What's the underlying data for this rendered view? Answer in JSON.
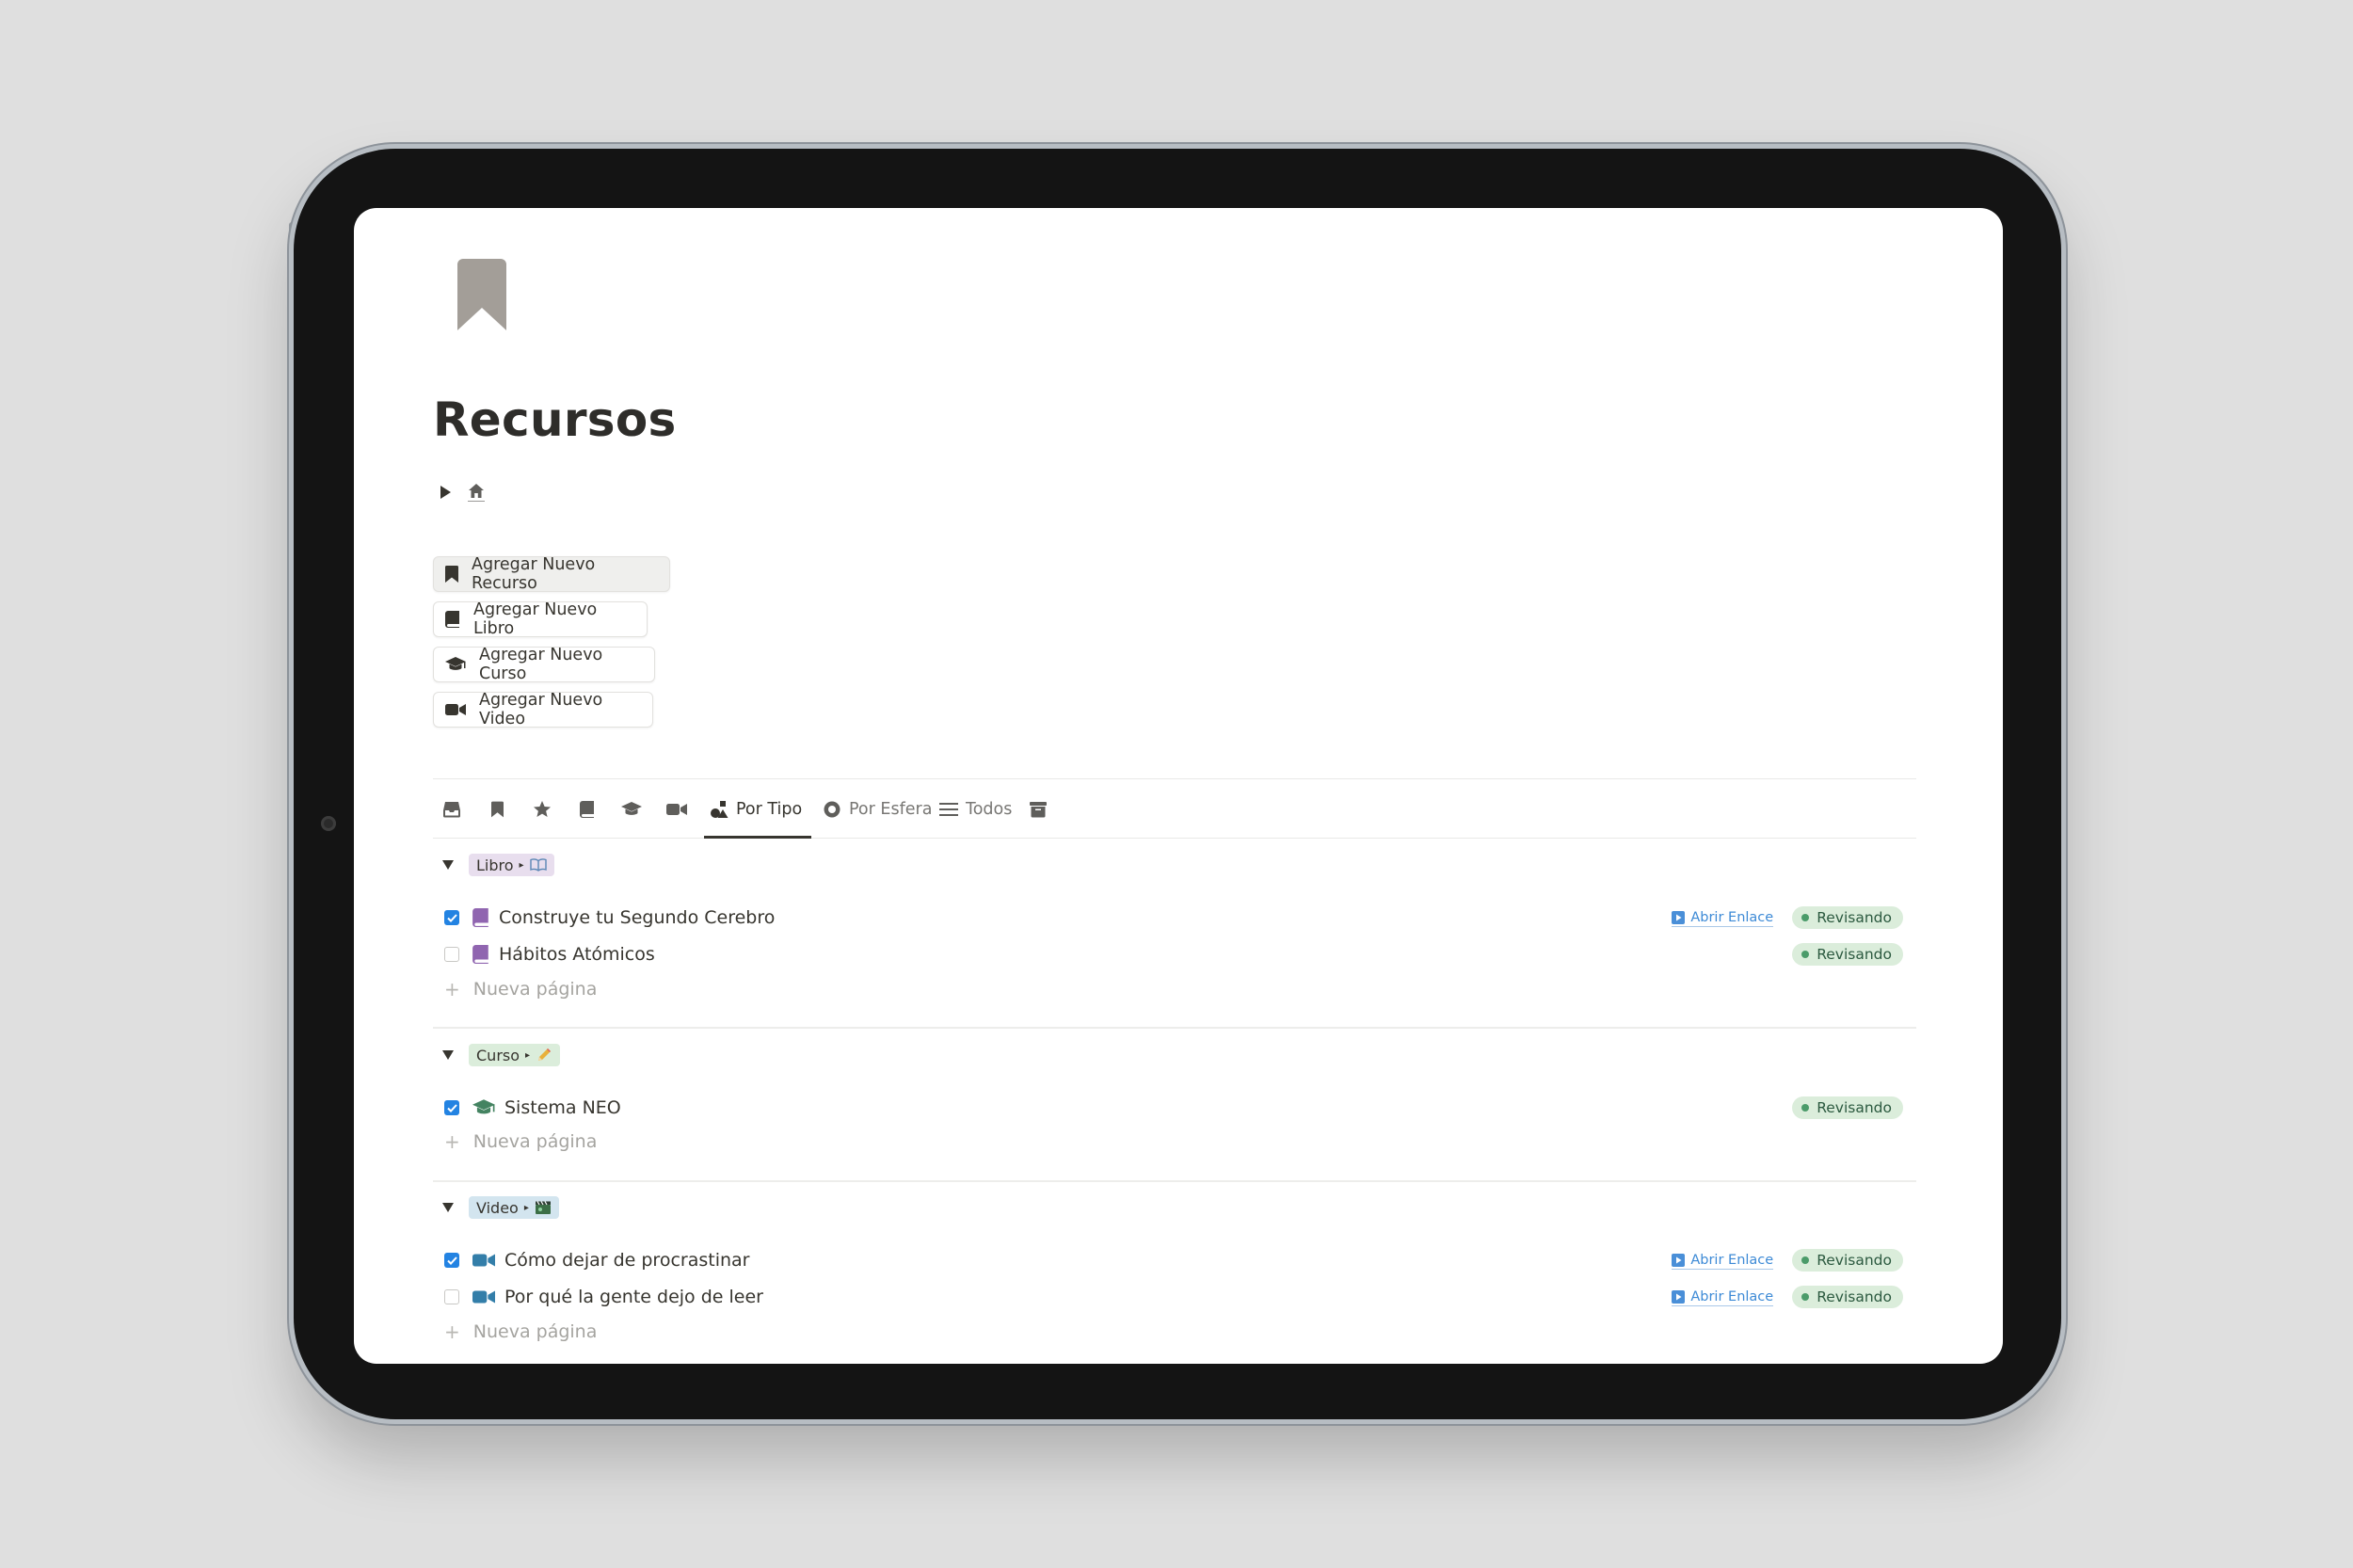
{
  "page": {
    "title": "Recursos"
  },
  "buttons": [
    {
      "label": "Agregar Nuevo Recurso",
      "icon": "bookmark-icon"
    },
    {
      "label": "Agregar Nuevo Libro",
      "icon": "book-icon"
    },
    {
      "label": "Agregar Nuevo Curso",
      "icon": "graduation-cap-icon"
    },
    {
      "label": "Agregar Nuevo Video",
      "icon": "video-camera-icon"
    }
  ],
  "tabs": [
    {
      "label": "",
      "icon": "inbox-icon"
    },
    {
      "label": "",
      "icon": "bookmark-icon"
    },
    {
      "label": "",
      "icon": "star-icon"
    },
    {
      "label": "",
      "icon": "book-icon"
    },
    {
      "label": "",
      "icon": "graduation-cap-icon"
    },
    {
      "label": "",
      "icon": "video-camera-icon"
    },
    {
      "label": "Por Tipo",
      "icon": "shapes-icon",
      "active": true
    },
    {
      "label": "Por Esfera",
      "icon": "circle-icon"
    },
    {
      "label": "Todos",
      "icon": "list-icon"
    },
    {
      "label": "",
      "icon": "archive-icon"
    }
  ],
  "groups": [
    {
      "tag": "Libro",
      "tag_color": "#e8deee",
      "tag_icon": "open-book-icon",
      "items": [
        {
          "title": "Construye tu Segundo Cerebro",
          "checked": true,
          "icon": "book-icon",
          "link": "Abrir Enlace",
          "status": "Revisando"
        },
        {
          "title": "Hábitos Atómicos",
          "checked": false,
          "icon": "book-icon",
          "link": "",
          "status": "Revisando"
        }
      ],
      "new_page": "Nueva página"
    },
    {
      "tag": "Curso",
      "tag_color": "#dbeddb",
      "tag_icon": "pencil-icon",
      "items": [
        {
          "title": "Sistema NEO",
          "checked": true,
          "icon": "graduation-cap-icon",
          "link": "",
          "status": "Revisando"
        }
      ],
      "new_page": "Nueva página"
    },
    {
      "tag": "Video",
      "tag_color": "#d3e5ef",
      "tag_icon": "film-clapper-icon",
      "items": [
        {
          "title": "Cómo dejar de procrastinar",
          "checked": true,
          "icon": "video-camera-icon",
          "link": "Abrir Enlace",
          "status": "Revisando"
        },
        {
          "title": "Por qué la gente dejo de leer",
          "checked": false,
          "icon": "video-camera-icon",
          "link": "Abrir Enlace",
          "status": "Revisando"
        }
      ],
      "new_page": "Nueva página"
    }
  ],
  "colors": {
    "checkbox_on": "#2383e2",
    "status_bg": "#dbeddb",
    "status_dot": "#4b9b6a",
    "link": "#3d8ad6",
    "book_icon": "#9065b0",
    "course_icon": "#448361",
    "video_icon": "#337ea9"
  }
}
